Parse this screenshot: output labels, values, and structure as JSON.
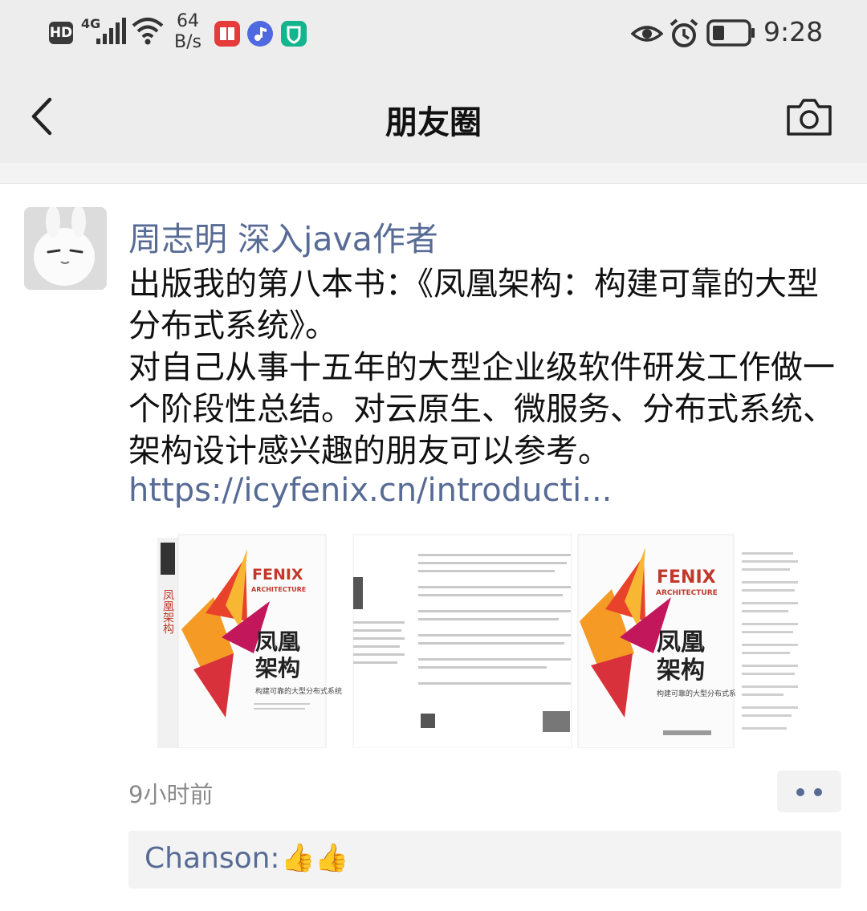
{
  "status_bar": {
    "hd": "HD",
    "network": "4G",
    "speed_value": "64",
    "speed_unit": "B/s",
    "time": "9:28"
  },
  "nav": {
    "title": "朋友圈"
  },
  "post": {
    "author": "周志明 深入java作者",
    "paragraphs": [
      "出版我的第八本书：《凤凰架构：构建可靠的大型分布式系统》。",
      "对自己从事十五年的大型企业级软件研发工作做一个阶段性总结。对云原生、微服务、分布式系统、架构设计感兴趣的朋友可以参考。"
    ],
    "link": "https://icyfenix.cn/introducti...",
    "time_ago": "9小时前",
    "book": {
      "brand": "FENIX",
      "brand_sub": "ARCHITECTURE",
      "title_line1": "凤凰",
      "title_line2": "架构",
      "subtitle": "构建可靠的大型分布式系统"
    },
    "comments": [
      {
        "name": "Chanson:",
        "emoji": "👍👍"
      }
    ]
  },
  "colors": {
    "link": "#576b95",
    "bar_bg": "#ededed",
    "phoenix_red": "#e8432a",
    "phoenix_orange": "#f59a25"
  }
}
